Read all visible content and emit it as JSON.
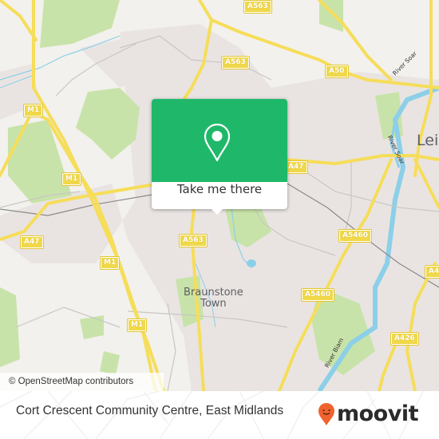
{
  "map": {
    "attribution": "© OpenStreetMap contributors",
    "colors": {
      "land": "#f2f1ed",
      "urban": "#e9e4e2",
      "park": "#c8e3a9",
      "water": "#8ccfe8",
      "road_major": "#f6dd5a",
      "road_minor": "#c9c6c3",
      "rail": "#8a8a8a"
    },
    "road_labels": [
      {
        "id": "a563-top",
        "text": "A563"
      },
      {
        "id": "a563-mid",
        "text": "A563"
      },
      {
        "id": "a50",
        "text": "A50"
      },
      {
        "id": "m1-upper",
        "text": "M1"
      },
      {
        "id": "m1-mid",
        "text": "M1"
      },
      {
        "id": "a47-west",
        "text": "A47"
      },
      {
        "id": "m1-lower",
        "text": "M1"
      },
      {
        "id": "m1-bottom",
        "text": "M1"
      },
      {
        "id": "a563-south",
        "text": "A563"
      },
      {
        "id": "a47-east",
        "text": "A47"
      },
      {
        "id": "a5460-upper",
        "text": "A5460"
      },
      {
        "id": "a5460-lower",
        "text": "A5460"
      },
      {
        "id": "a426",
        "text": "A426"
      },
      {
        "id": "a4-edge",
        "text": "A4"
      }
    ],
    "place_labels": [
      {
        "id": "braunstone-town",
        "text": "Braunstone\nTown"
      },
      {
        "id": "leicester",
        "text": "Lei"
      }
    ],
    "water_labels": [
      {
        "id": "river-soar-north",
        "text": "River Soar"
      },
      {
        "id": "river-soar-south",
        "text": "River Soar"
      },
      {
        "id": "river-biam",
        "text": "River Biam"
      }
    ]
  },
  "popup": {
    "icon": "location-pin-icon",
    "button_label": "Take me there",
    "color": "#1fb86a"
  },
  "footer": {
    "place_title": "Cort Crescent Community Centre, East Midlands",
    "brand": "moovit",
    "brand_color": "#f0622e"
  }
}
